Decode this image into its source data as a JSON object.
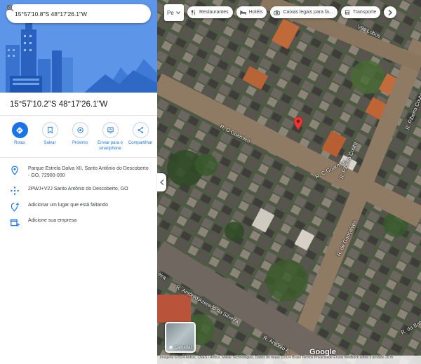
{
  "search": {
    "value": "15°57'10.8\"S 48°17'26.1\"W"
  },
  "place": {
    "coordinates": "15°57'10.2\"S 48°17'26.1\"W"
  },
  "actions": [
    {
      "label": "Rotas",
      "icon": "directions-icon"
    },
    {
      "label": "Salvar",
      "icon": "bookmark-icon"
    },
    {
      "label": "Próximo",
      "icon": "nearby-icon"
    },
    {
      "label": "Enviar para o smartphone",
      "icon": "send-to-phone-icon"
    },
    {
      "label": "Compartilhar",
      "icon": "share-icon"
    }
  ],
  "info": {
    "address": "Parque Estrela Dalva XII, Santo Antônio do Descoberto - GO, 72900-000",
    "plus_code": "2PWJ+V2J Santo Antônio do Descoberto, GO",
    "add_place": "Adicionar um lugar que está faltando",
    "add_business": "Adicione sua empresa"
  },
  "map": {
    "first_chip": "Pe",
    "chips": [
      {
        "label": "Restaurantes",
        "icon": "restaurant-icon"
      },
      {
        "label": "Hotéis",
        "icon": "hotel-icon"
      },
      {
        "label": "Caixas legais para fa...",
        "icon": "camera-icon"
      },
      {
        "label": "Transporte",
        "icon": "transit-icon"
      }
    ],
    "streets": {
      "s1": "R. C Guarnieri",
      "s2": "R. C Guarnieri",
      "s3": "R. Ribeiro Couto",
      "s4": "R. Ribeiro Couto",
      "s5": "R. de Gonçalves",
      "s6": "R. Antônio Azeredo da Silveira",
      "s7": "R. Antônio A.",
      "s8": "R. da Bahia",
      "s9": "Vila Lobos",
      "s10": "eira"
    },
    "layers_label": "Camadas",
    "google": "Google",
    "attribution": "Imagens ©2024 Airbus, CNES / Airbus, Maxar Technologies, Dados do mapa ©2024   Brasil   Termos   Privacidade   Enviar feedback sobre o produto   20 m"
  }
}
